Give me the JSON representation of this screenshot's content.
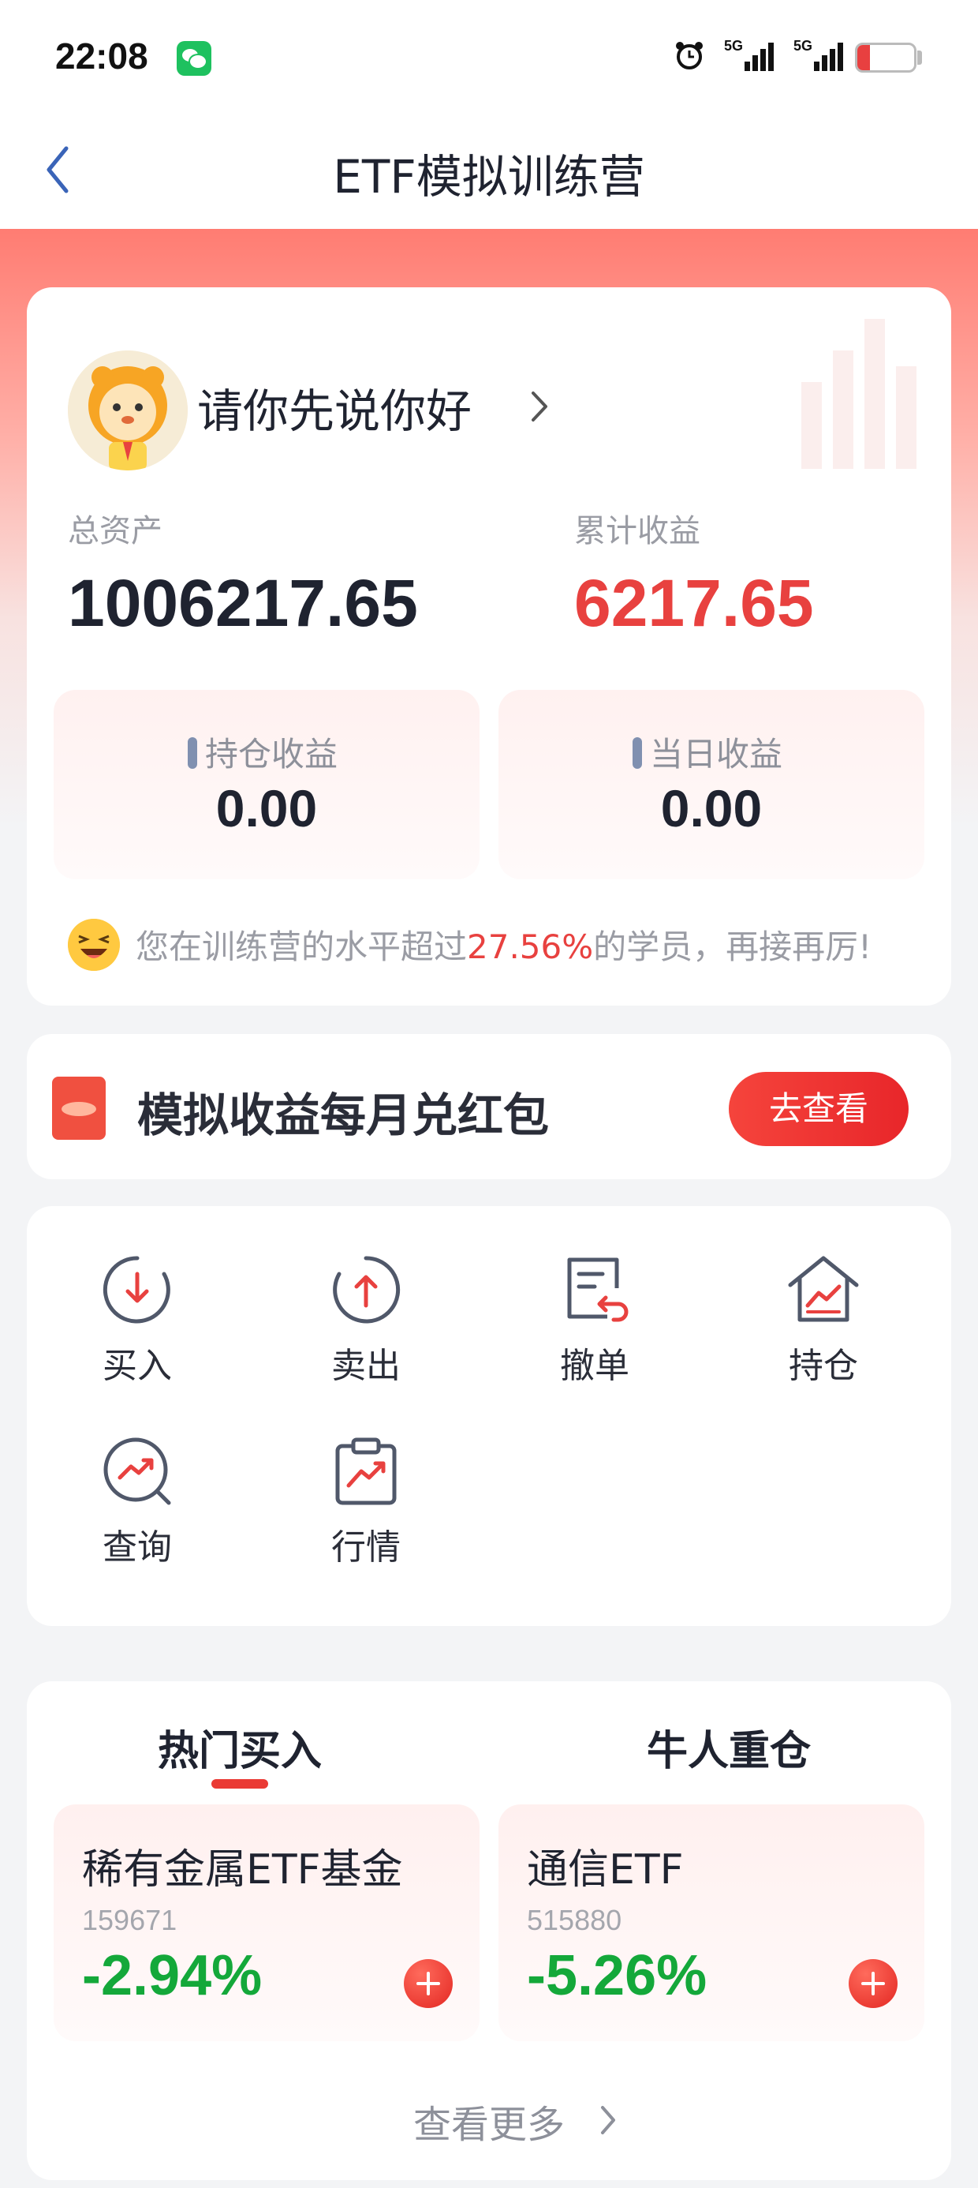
{
  "status_bar": {
    "time": "22:08",
    "signal1_label": "5G",
    "signal2_label": "5G",
    "battery": "14"
  },
  "header": {
    "title": "ETF模拟训练营",
    "back_icon": "chevron-left-icon"
  },
  "profile": {
    "username": "请你先说你好",
    "total_assets_label": "总资产",
    "total_assets": "1006217.65",
    "cumulative_profit_label": "累计收益",
    "cumulative_profit": "6217.65",
    "position_profit_label": "持仓收益",
    "position_profit": "0.00",
    "daily_profit_label": "当日收益",
    "daily_profit": "0.00",
    "level_prefix": "您在训练营的水平超过",
    "level_percent": "27.56%",
    "level_suffix": "的学员，再接再厉!",
    "colors": {
      "profit": "#e8413f",
      "accent": "#ea3a34"
    }
  },
  "promo": {
    "text": "模拟收益每月兑红包",
    "button": "去查看"
  },
  "actions": [
    {
      "label": "买入",
      "icon": "buy-arrow-down-icon"
    },
    {
      "label": "卖出",
      "icon": "sell-arrow-up-icon"
    },
    {
      "label": "撤单",
      "icon": "cancel-order-icon"
    },
    {
      "label": "持仓",
      "icon": "holdings-house-icon"
    },
    {
      "label": "查询",
      "icon": "query-magnifier-icon"
    },
    {
      "label": "行情",
      "icon": "market-clipboard-icon"
    }
  ],
  "hot": {
    "tab_hot": "热门买入",
    "tab_expert": "牛人重仓",
    "funds": [
      {
        "name": "稀有金属ETF基金",
        "code": "159671",
        "change": "-2.94%"
      },
      {
        "name": "通信ETF",
        "code": "515880",
        "change": "-5.26%"
      }
    ],
    "more": "查看更多",
    "colors": {
      "down": "#14a83a"
    }
  }
}
